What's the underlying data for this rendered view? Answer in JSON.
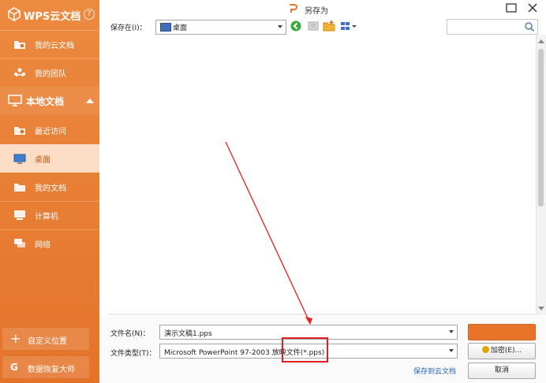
{
  "sidebar": {
    "brand": "WPS云文档",
    "help": "?",
    "cloud_items": [
      {
        "label": "我的云文档",
        "icon": "cloud-folder-icon"
      },
      {
        "label": "我的团队",
        "icon": "team-icon"
      }
    ],
    "section": {
      "label": "本地文档",
      "icon": "monitor-icon"
    },
    "local_items": [
      {
        "label": "最近访问",
        "icon": "recent-folder-icon"
      },
      {
        "label": "桌面",
        "icon": "desktop-icon",
        "active": true
      },
      {
        "label": "我的文档",
        "icon": "folder-icon"
      },
      {
        "label": "计算机",
        "icon": "computer-icon"
      },
      {
        "label": "网络",
        "icon": "network-icon"
      }
    ],
    "bottom": [
      {
        "label": "自定义位置",
        "icon": "plus-icon",
        "glyph": "+"
      },
      {
        "label": "数据恢复大师",
        "icon": "recovery-icon",
        "glyph": "G"
      }
    ]
  },
  "titlebar": {
    "title": "另存为"
  },
  "toolbar": {
    "save_in_label": "保存在(I)：",
    "save_in_value": "桌面"
  },
  "form": {
    "filename_label": "文件名(N)：",
    "filename_value": "演示文稿1.pps",
    "filetype_label": "文件类型(T)：",
    "filetype_value": "Microsoft PowerPoint 97-2003 放映文件(*.pps)",
    "encrypt_label": "加密(E)...",
    "cloud_link": "保存到云文档",
    "cancel_label": "取消"
  },
  "colors": {
    "accent": "#e8742a",
    "annotation": "#e02020",
    "link": "#2a63b8"
  }
}
